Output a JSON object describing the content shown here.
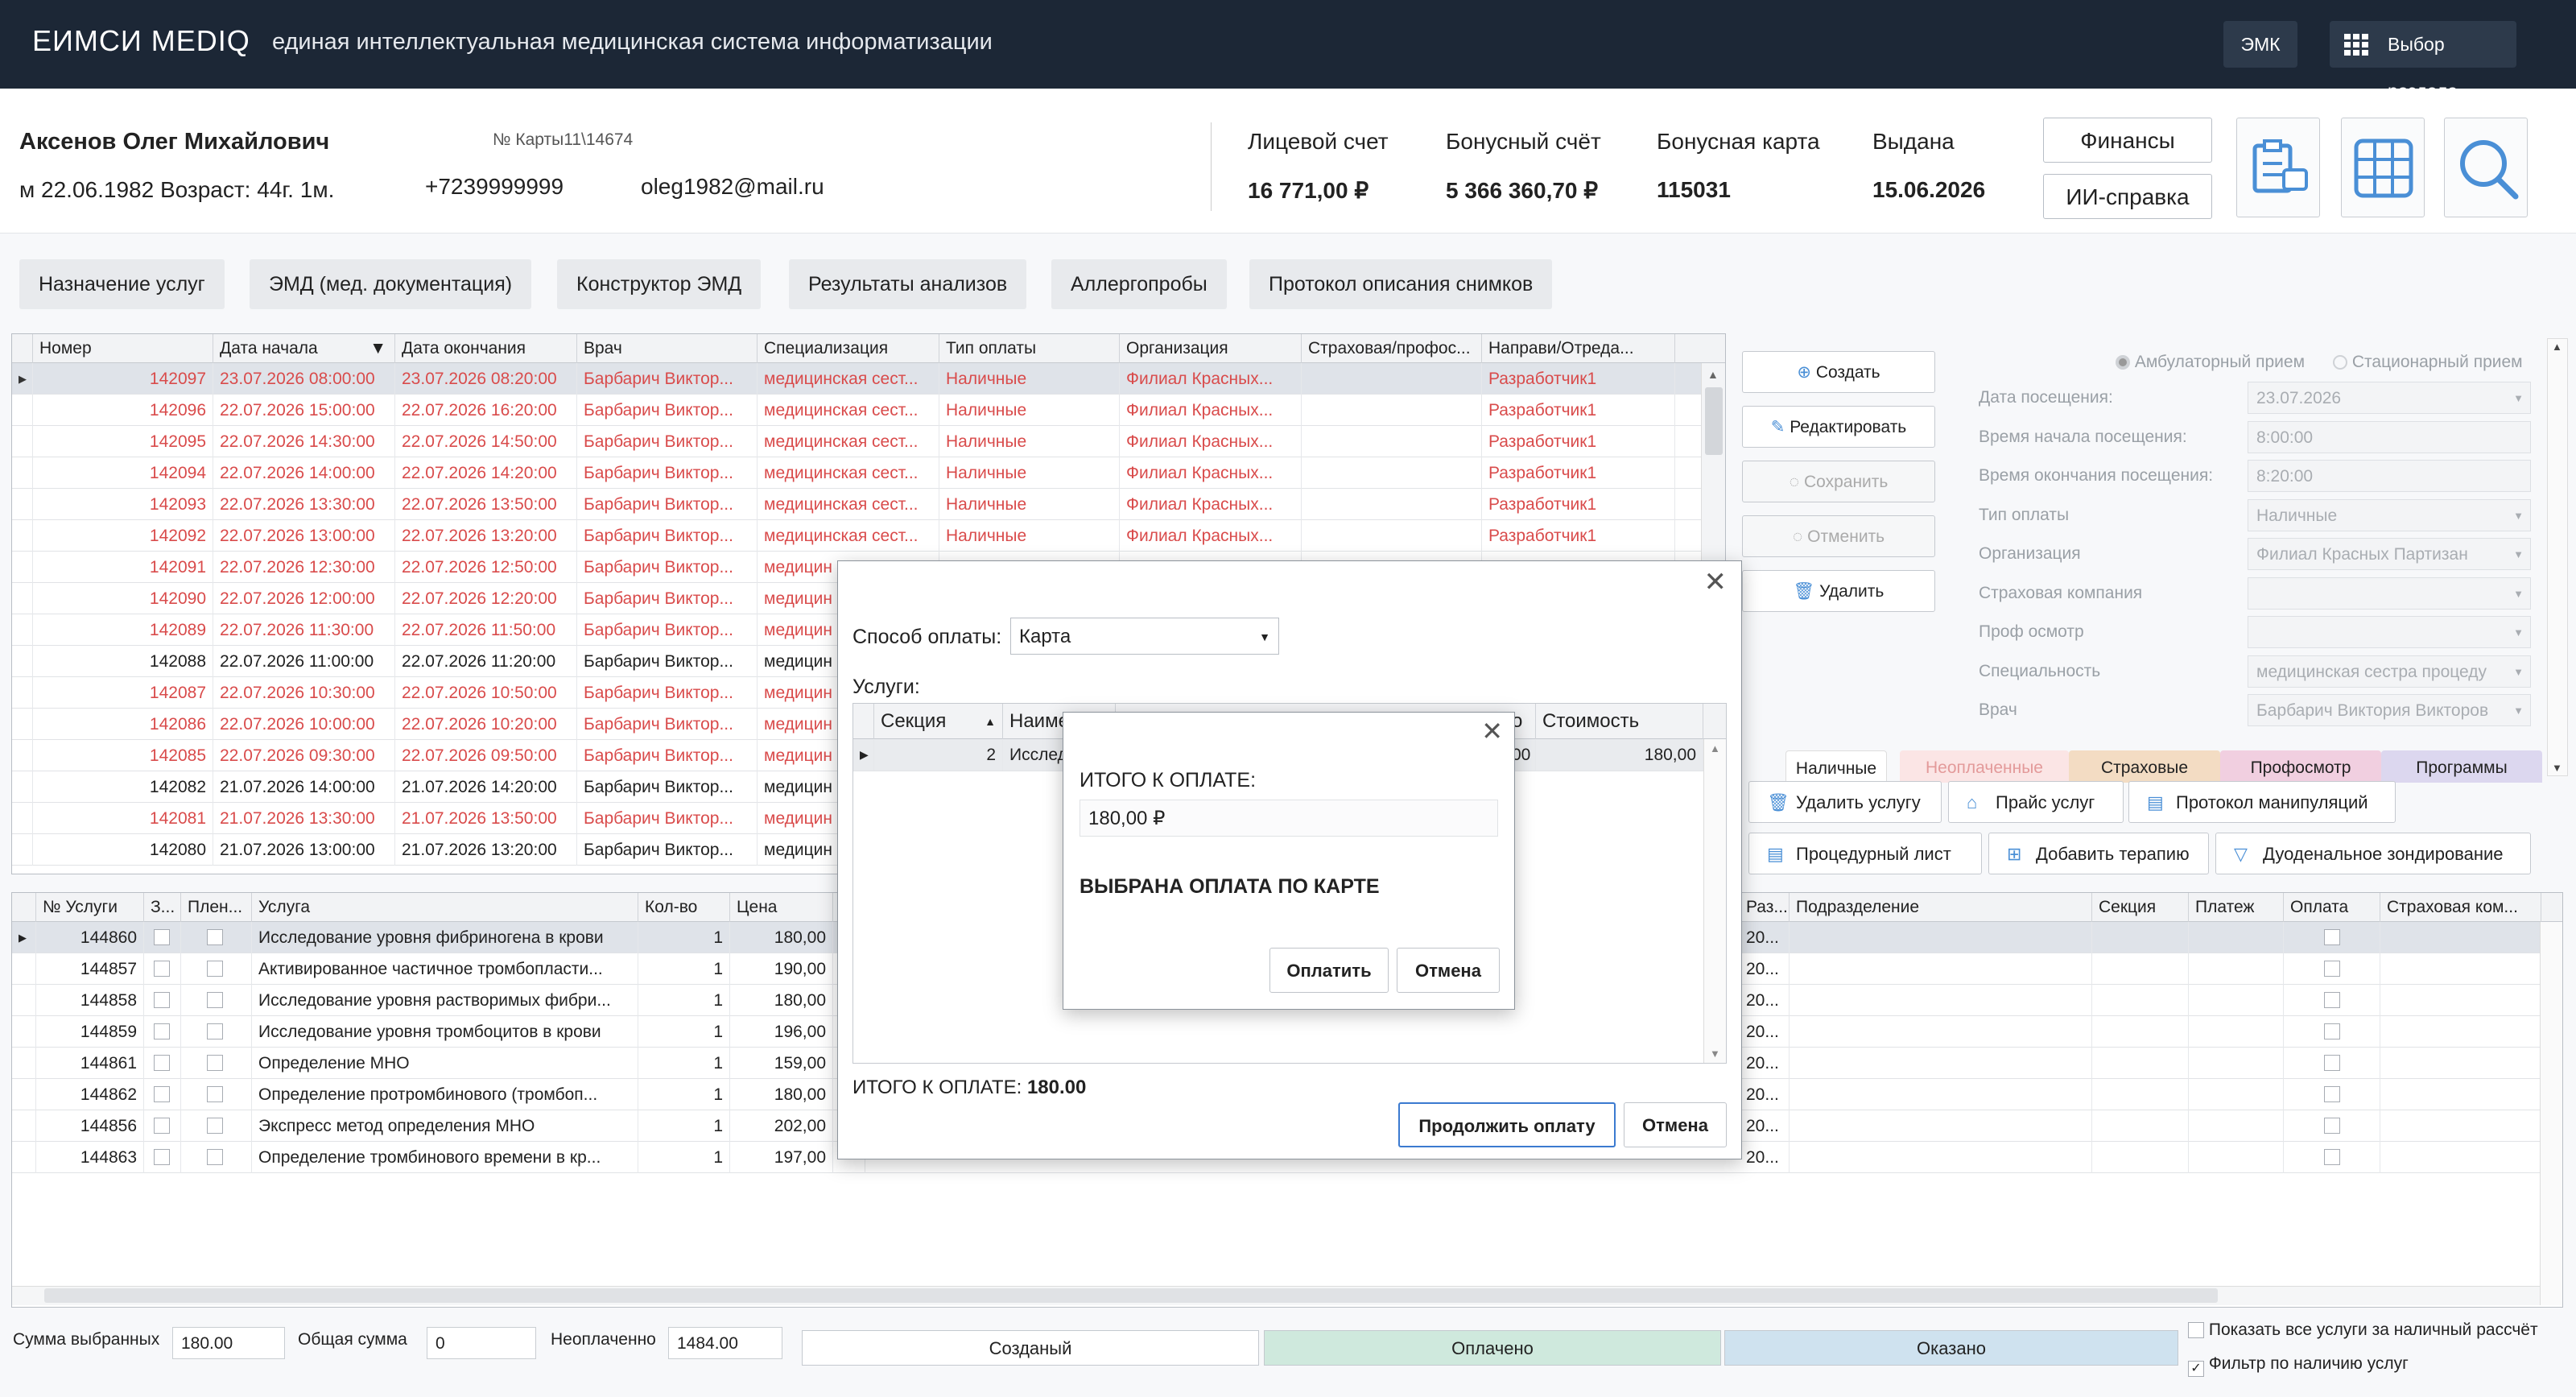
{
  "header": {
    "logo": "ЕИМСИ MEDIQ",
    "subtitle": "единая интеллектуальная медицинская система информатизации",
    "emk_button": "ЭМК",
    "section_button": "Выбор раздела"
  },
  "patient": {
    "name": "Аксенов Олег Михайлович",
    "card_no": "№ Карты11\\14674",
    "birth": "м 22.06.1982 Возраст: 44г. 1м.",
    "phone": "+7239999999",
    "email": "oleg1982@mail.ru",
    "account_label": "Лицевой счет",
    "account_value": "16 771,00 ₽",
    "bonus_account_label": "Бонусный счёт",
    "bonus_account_value": "5 366 360,70 ₽",
    "bonus_card_label": "Бонусная карта",
    "bonus_card_value": "115031",
    "issued_label": "Выдана",
    "issued_value": "15.06.2026",
    "finance_button": "Финансы",
    "ai_button": "ИИ-справка"
  },
  "tabs": [
    "Назначение услуг",
    "ЭМД (мед. документация)",
    "Конструктор ЭМД",
    "Результаты анализов",
    "Аллергопробы",
    "Протокол описания снимков"
  ],
  "visits_table": {
    "columns": [
      "Номер",
      "Дата начала",
      "Дата окончания",
      "Врач",
      "Специализация",
      "Тип оплаты",
      "Организация",
      "Страховая/профос...",
      "Направи/Отреда..."
    ],
    "rows": [
      {
        "num": "142097",
        "start": "23.07.2026 08:00:00",
        "end": "23.07.2026 08:20:00",
        "doctor": "Барбарич Виктор...",
        "spec": "медицинская сест...",
        "pay": "Наличные",
        "org": "Филиал Красных...",
        "ins": "",
        "dir": "Разработчик1",
        "red": true,
        "sel": true
      },
      {
        "num": "142096",
        "start": "22.07.2026 15:00:00",
        "end": "22.07.2026 16:20:00",
        "doctor": "Барбарич Виктор...",
        "spec": "медицинская сест...",
        "pay": "Наличные",
        "org": "Филиал Красных...",
        "ins": "",
        "dir": "Разработчик1",
        "red": true
      },
      {
        "num": "142095",
        "start": "22.07.2026 14:30:00",
        "end": "22.07.2026 14:50:00",
        "doctor": "Барбарич Виктор...",
        "spec": "медицинская сест...",
        "pay": "Наличные",
        "org": "Филиал Красных...",
        "ins": "",
        "dir": "Разработчик1",
        "red": true
      },
      {
        "num": "142094",
        "start": "22.07.2026 14:00:00",
        "end": "22.07.2026 14:20:00",
        "doctor": "Барбарич Виктор...",
        "spec": "медицинская сест...",
        "pay": "Наличные",
        "org": "Филиал Красных...",
        "ins": "",
        "dir": "Разработчик1",
        "red": true
      },
      {
        "num": "142093",
        "start": "22.07.2026 13:30:00",
        "end": "22.07.2026 13:50:00",
        "doctor": "Барбарич Виктор...",
        "spec": "медицинская сест...",
        "pay": "Наличные",
        "org": "Филиал Красных...",
        "ins": "",
        "dir": "Разработчик1",
        "red": true
      },
      {
        "num": "142092",
        "start": "22.07.2026 13:00:00",
        "end": "22.07.2026 13:20:00",
        "doctor": "Барбарич Виктор...",
        "spec": "медицинская сест...",
        "pay": "Наличные",
        "org": "Филиал Красных...",
        "ins": "",
        "dir": "Разработчик1",
        "red": true
      },
      {
        "num": "142091",
        "start": "22.07.2026 12:30:00",
        "end": "22.07.2026 12:50:00",
        "doctor": "Барбарич Виктор...",
        "spec": "медицин",
        "red": true
      },
      {
        "num": "142090",
        "start": "22.07.2026 12:00:00",
        "end": "22.07.2026 12:20:00",
        "doctor": "Барбарич Виктор...",
        "spec": "медицин",
        "red": true
      },
      {
        "num": "142089",
        "start": "22.07.2026 11:30:00",
        "end": "22.07.2026 11:50:00",
        "doctor": "Барбарич Виктор...",
        "spec": "медицин",
        "red": true
      },
      {
        "num": "142088",
        "start": "22.07.2026 11:00:00",
        "end": "22.07.2026 11:20:00",
        "doctor": "Барбарич Виктор...",
        "spec": "медицин",
        "red": false
      },
      {
        "num": "142087",
        "start": "22.07.2026 10:30:00",
        "end": "22.07.2026 10:50:00",
        "doctor": "Барбарич Виктор...",
        "spec": "медицин",
        "red": true
      },
      {
        "num": "142086",
        "start": "22.07.2026 10:00:00",
        "end": "22.07.2026 10:20:00",
        "doctor": "Барбарич Виктор...",
        "spec": "медицин",
        "red": true
      },
      {
        "num": "142085",
        "start": "22.07.2026 09:30:00",
        "end": "22.07.2026 09:50:00",
        "doctor": "Барбарич Виктор...",
        "spec": "медицин",
        "red": true
      },
      {
        "num": "142082",
        "start": "21.07.2026 14:00:00",
        "end": "21.07.2026 14:20:00",
        "doctor": "Барбарич Виктор...",
        "spec": "медицин",
        "red": false
      },
      {
        "num": "142081",
        "start": "21.07.2026 13:30:00",
        "end": "21.07.2026 13:50:00",
        "doctor": "Барбарич Виктор...",
        "spec": "медицин",
        "red": true
      },
      {
        "num": "142080",
        "start": "21.07.2026 13:00:00",
        "end": "21.07.2026 13:20:00",
        "doctor": "Барбарич Виктор...",
        "spec": "медицин",
        "red": false
      }
    ]
  },
  "side_buttons": {
    "create": "Создать",
    "edit": "Редактировать",
    "save": "Сохранить",
    "cancel": "Отменить",
    "delete": "Удалить"
  },
  "visit_form": {
    "radio_out": "Амбулаторный прием",
    "radio_in": "Стационарный прием",
    "fields": [
      {
        "label": "Дата посещения:",
        "value": "23.07.2026"
      },
      {
        "label": "Время начала посещения:",
        "value": "8:00:00"
      },
      {
        "label": "Время окончания посещения:",
        "value": "8:20:00"
      },
      {
        "label": "Тип оплаты",
        "value": "Наличные"
      },
      {
        "label": "Организация",
        "value": "Филиал Красных Партизан"
      },
      {
        "label": "Страховая компания",
        "value": ""
      },
      {
        "label": "Проф осмотр",
        "value": ""
      },
      {
        "label": "Специальность",
        "value": "медицинская сестра процеду"
      },
      {
        "label": "Врач",
        "value": "Барбарич Виктория Викторов"
      }
    ]
  },
  "filter_tabs": [
    "Наличные",
    "Неоплаченные",
    "Страховые",
    "Профосмотр",
    "Программы"
  ],
  "tool_buttons": [
    "Удалить услугу",
    "Прайс услуг",
    "Протокол манипуляций",
    "Процедурный лист",
    "Добавить терапию",
    "Дуоденальное зондирование"
  ],
  "services_table": {
    "columns": [
      "№ Услуги",
      "З...",
      "Плен...",
      "Услуга",
      "Кол-во",
      "Цена",
      "Ц"
    ],
    "right_columns": [
      "Раз...",
      "Подразделение",
      "Секция",
      "Платеж",
      "Оплата",
      "Страховая ком..."
    ],
    "rows": [
      {
        "num": "144860",
        "name": "Исследование уровня фибриногена в крови",
        "qty": "1",
        "price": "180,00",
        "r": "20..."
      },
      {
        "num": "144857",
        "name": "Активированное частичное тромбопласти...",
        "qty": "1",
        "price": "190,00",
        "r": "20..."
      },
      {
        "num": "144858",
        "name": "Исследование уровня растворимых фибри...",
        "qty": "1",
        "price": "180,00",
        "r": "20..."
      },
      {
        "num": "144859",
        "name": "Исследование уровня тромбоцитов в крови",
        "qty": "1",
        "price": "196,00",
        "r": "20..."
      },
      {
        "num": "144861",
        "name": "Определение МНО",
        "qty": "1",
        "price": "159,00",
        "r": "20..."
      },
      {
        "num": "144862",
        "name": "Определение протромбинового (тромбоп...",
        "qty": "1",
        "price": "180,00",
        "r": "20..."
      },
      {
        "num": "144856",
        "name": "Экспресс метод определения МНО",
        "qty": "1",
        "price": "202,00",
        "r": "20..."
      },
      {
        "num": "144863",
        "name": "Определение тромбинового времени в кр...",
        "qty": "1",
        "price": "197,00",
        "r": "20..."
      }
    ]
  },
  "payment_dialog": {
    "method_label": "Способ оплаты:",
    "method_value": "Карта",
    "services_label": "Услуги:",
    "columns": [
      "Секция",
      "Наиме",
      "о",
      "Стоимость"
    ],
    "row": {
      "section": "2",
      "name": "Исследо",
      "extra": "00",
      "cost": "180,00"
    },
    "total_label": "ИТОГО К ОПЛАТЕ:",
    "total_value": "180.00",
    "continue_button": "Продолжить оплату",
    "cancel_button": "Отмена"
  },
  "confirm_dialog": {
    "total_label": "ИТОГО К ОПЛАТЕ:",
    "total_value": "180,00 ₽",
    "message": "ВЫБРАНА ОПЛАТА ПО КАРТЕ",
    "pay_button": "Оплатить",
    "cancel_button": "Отмена"
  },
  "statusbar": {
    "selected_label": "Сумма выбранных",
    "selected_value": "180.00",
    "total_label": "Общая сумма",
    "total_value": "0",
    "unpaid_label": "Неоплаченно",
    "unpaid_value": "1484.00",
    "state_created": "Созданый",
    "state_paid": "Оплачено",
    "state_done": "Оказано",
    "chk_all": "Показать все услуги за наличный рассчёт",
    "chk_filter": "Фильтр по наличию услуг"
  },
  "colors": {
    "topbar": "#1c2736",
    "paid": "#cfe9dd",
    "done": "#cfe2ef",
    "red_text": "#d94b4b"
  }
}
